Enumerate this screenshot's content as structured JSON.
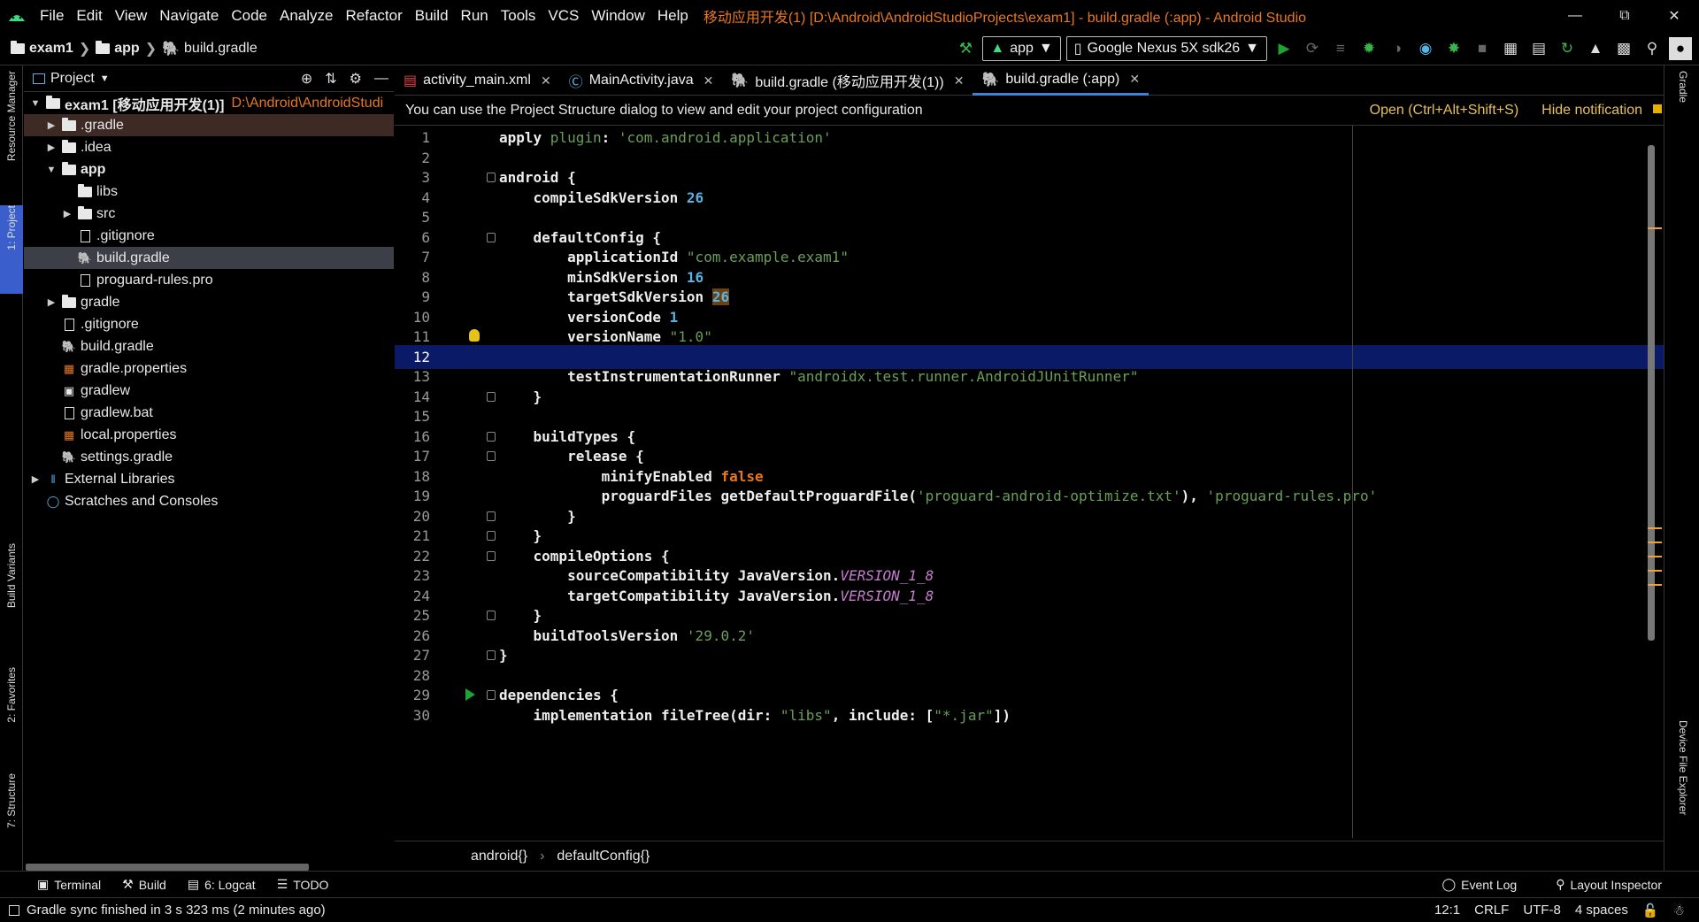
{
  "menu": [
    "File",
    "Edit",
    "View",
    "Navigate",
    "Code",
    "Analyze",
    "Refactor",
    "Build",
    "Run",
    "Tools",
    "VCS",
    "Window",
    "Help"
  ],
  "window_title": "移动应用开发(1) [D:\\Android\\AndroidStudioProjects\\exam1] - build.gradle (:app) - Android Studio",
  "breadcrumb": [
    "exam1",
    "app",
    "build.gradle"
  ],
  "run_config": "app",
  "device": "Google Nexus 5X sdk26",
  "left_strip_tabs": [
    "Resource Manager",
    "1: Project",
    "Build Variants",
    "2: Favorites",
    "7: Structure"
  ],
  "project_panel": {
    "title": "Project",
    "tree": [
      {
        "label": "exam1 [移动应用开发(1)]",
        "hint": "D:\\Android\\AndroidStudi",
        "depth": 0,
        "arrow": "▼",
        "icon": "folder-icon"
      },
      {
        "label": ".gradle",
        "depth": 1,
        "arrow": "▶",
        "icon": "folder-icon",
        "state": "gradle"
      },
      {
        "label": ".idea",
        "depth": 1,
        "arrow": "▶",
        "icon": "folder-icon"
      },
      {
        "label": "app",
        "depth": 1,
        "arrow": "▼",
        "icon": "folder-icon"
      },
      {
        "label": "libs",
        "depth": 2,
        "arrow": "",
        "icon": "folder-icon"
      },
      {
        "label": "src",
        "depth": 2,
        "arrow": "▶",
        "icon": "folder-icon"
      },
      {
        "label": ".gitignore",
        "depth": 2,
        "arrow": "",
        "icon": "file-icon"
      },
      {
        "label": "build.gradle",
        "depth": 2,
        "arrow": "",
        "icon": "gradle-icon",
        "state": "selected"
      },
      {
        "label": "proguard-rules.pro",
        "depth": 2,
        "arrow": "",
        "icon": "file-icon"
      },
      {
        "label": "gradle",
        "depth": 1,
        "arrow": "▶",
        "icon": "folder-icon"
      },
      {
        "label": ".gitignore",
        "depth": 1,
        "arrow": "",
        "icon": "file-icon"
      },
      {
        "label": "build.gradle",
        "depth": 1,
        "arrow": "",
        "icon": "gradle-icon"
      },
      {
        "label": "gradle.properties",
        "depth": 1,
        "arrow": "",
        "icon": "properties-icon"
      },
      {
        "label": "gradlew",
        "depth": 1,
        "arrow": "",
        "icon": "terminal-file-icon"
      },
      {
        "label": "gradlew.bat",
        "depth": 1,
        "arrow": "",
        "icon": "file-icon"
      },
      {
        "label": "local.properties",
        "depth": 1,
        "arrow": "",
        "icon": "properties-icon"
      },
      {
        "label": "settings.gradle",
        "depth": 1,
        "arrow": "",
        "icon": "gradle-icon"
      },
      {
        "label": "External Libraries",
        "depth": 0,
        "arrow": "▶",
        "icon": "libraries-icon"
      },
      {
        "label": "Scratches and Consoles",
        "depth": 0,
        "arrow": "",
        "icon": "scratches-icon"
      }
    ]
  },
  "tabs": [
    {
      "label": "activity_main.xml",
      "icon": "xml-icon"
    },
    {
      "label": "MainActivity.java",
      "icon": "class-icon"
    },
    {
      "label": "build.gradle (移动应用开发(1))",
      "icon": "gradle-icon"
    },
    {
      "label": "build.gradle (:app)",
      "icon": "gradle-icon",
      "active": true
    }
  ],
  "notification": {
    "text": "You can use the Project Structure dialog to view and edit your project configuration",
    "open_link": "Open (Ctrl+Alt+Shift+S)",
    "hide_link": "Hide notification"
  },
  "code_lines": [
    "apply plugin: 'com.android.application'",
    "",
    "android {",
    "    compileSdkVersion 26",
    "",
    "    defaultConfig {",
    "        applicationId \"com.example.exam1\"",
    "        minSdkVersion 16",
    "        targetSdkVersion 26",
    "        versionCode 1",
    "        versionName \"1.0\"",
    "",
    "        testInstrumentationRunner \"androidx.test.runner.AndroidJUnitRunner\"",
    "    }",
    "",
    "    buildTypes {",
    "        release {",
    "            minifyEnabled false",
    "            proguardFiles getDefaultProguardFile('proguard-android-optimize.txt'), 'proguard-rules.pro'",
    "        }",
    "    }",
    "    compileOptions {",
    "        sourceCompatibility JavaVersion.VERSION_1_8",
    "        targetCompatibility JavaVersion.VERSION_1_8",
    "    }",
    "    buildToolsVersion '29.0.2'",
    "}",
    "",
    "dependencies {",
    "    implementation fileTree(dir: \"libs\", include: [\"*.jar\"])"
  ],
  "caret_line": 12,
  "editor_breadcrumb": [
    "android{}",
    "defaultConfig{}"
  ],
  "right_strip_tabs": [
    "Gradle",
    "Device File Explorer"
  ],
  "tool_windows": [
    {
      "label": "Terminal",
      "icon": "terminal-icon"
    },
    {
      "label": "Build",
      "icon": "hammer-icon"
    },
    {
      "label": "6: Logcat",
      "icon": "logcat-icon"
    },
    {
      "label": "TODO",
      "icon": "todo-icon"
    }
  ],
  "tool_windows_right": [
    {
      "label": "Event Log",
      "icon": "event-log-icon"
    },
    {
      "label": "Layout Inspector",
      "icon": "layout-inspector-icon"
    }
  ],
  "status": {
    "message": "Gradle sync finished in 3 s 323 ms (2 minutes ago)",
    "position": "12:1",
    "line_sep": "CRLF",
    "encoding": "UTF-8",
    "indent": "4 spaces"
  }
}
